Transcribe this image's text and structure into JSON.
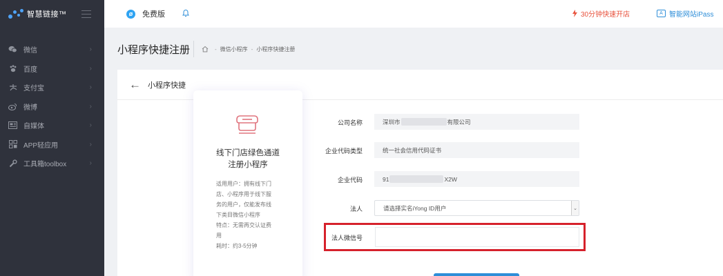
{
  "brand": {
    "name": "智慧链接™"
  },
  "sidebar": {
    "items": [
      {
        "label": "微信",
        "icon": "wechat-icon"
      },
      {
        "label": "百度",
        "icon": "paw-icon"
      },
      {
        "label": "支付宝",
        "icon": "alipay-icon"
      },
      {
        "label": "微博",
        "icon": "weibo-icon"
      },
      {
        "label": "自媒体",
        "icon": "media-icon"
      },
      {
        "label": "APP轻应用",
        "icon": "grid-icon"
      },
      {
        "label": "工具箱toolbox",
        "icon": "wrench-icon"
      }
    ]
  },
  "topbar": {
    "version": "免费版",
    "promo": "30分钟快速开店",
    "ipass": "智能网站iPass"
  },
  "page": {
    "title": "小程序快捷注册",
    "breadcrumb": [
      "微信小程序",
      "小程序快捷注册"
    ]
  },
  "panel": {
    "title": "小程序快捷"
  },
  "card": {
    "title_line1": "线下门店绿色通道",
    "title_line2": "注册小程序",
    "desc": [
      "适用用户：拥有线下门",
      "店、小程序用于线下服",
      "务的用户，仅能发布线",
      "下类目微信小程序",
      "特点：无需再交认证费",
      "用",
      "耗时：约3-5分钟"
    ]
  },
  "form": {
    "company": {
      "label": "公司名称",
      "prefix": "深圳市",
      "suffix": "有限公司"
    },
    "code_type": {
      "label": "企业代码类型",
      "value": "统一社会信用代码证书"
    },
    "code": {
      "label": "企业代码",
      "prefix": "91",
      "suffix": "X2W"
    },
    "legal": {
      "label": "法人",
      "value": "请选择实名iYong ID用户"
    },
    "legal_wx": {
      "label": "法人微信号",
      "value": ""
    }
  },
  "colors": {
    "sidebar": "#2f323c",
    "accent": "#2e8ed8",
    "promo": "#e8533e",
    "highlight": "#d6212b"
  }
}
